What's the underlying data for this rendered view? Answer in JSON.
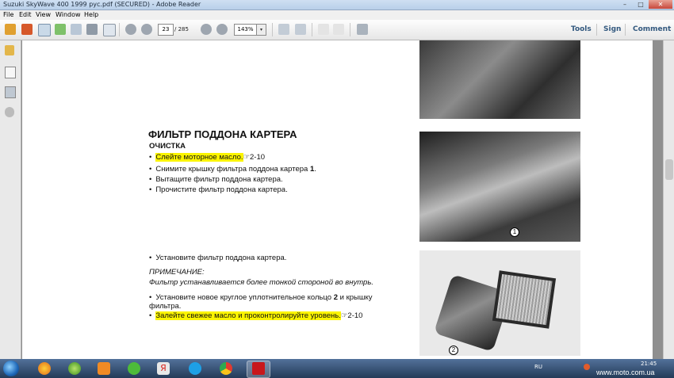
{
  "window": {
    "title": "Suzuki SkyWave 400 1999 рус.pdf (SECURED) - Adobe Reader",
    "controls": [
      "–",
      "□",
      "✕"
    ]
  },
  "menubar": {
    "items": [
      "File",
      "Edit",
      "View",
      "Window",
      "Help"
    ]
  },
  "toolbar": {
    "current_page": "23",
    "total_pages": "/ 285",
    "zoom": "143%",
    "right_links": [
      "Tools",
      "Sign",
      "Comment"
    ]
  },
  "document": {
    "heading": "ФИЛЬТР ПОДДОНА КАРТЕРА",
    "subheading": "ОЧИСТКА",
    "steps_top": [
      {
        "bullet": "•",
        "text": "Слейте моторное масло.",
        "highlighted": true,
        "ref": "☞2-10"
      },
      {
        "bullet": "•",
        "text": "Снимите крышку фильтра поддона картера",
        "bold_suffix": "1",
        "end": "."
      },
      {
        "bullet": "•",
        "text": "Вытащите фильтр поддона картера."
      },
      {
        "bullet": "•",
        "text": "Прочистите фильтр поддона картера."
      }
    ],
    "step_install": {
      "bullet": "•",
      "text": "Установите фильтр поддона картера."
    },
    "note_title": "ПРИМЕЧАНИЕ:",
    "note_text": "Фильтр устанавливается более тонкой стороной во внутрь.",
    "step_oring_1": "Установите новое круглое уплотнительное кольцо",
    "step_oring_bold": "2",
    "step_oring_2": "и крышку",
    "step_oring_3": "фильтра.",
    "step_oil": {
      "bullet": "•",
      "text": "Залейте свежее масло и проконтролируйте уровень.",
      "ref": "☞2-10"
    },
    "callouts": [
      "1",
      "2"
    ]
  },
  "taskbar": {
    "tray_lang": "RU",
    "time": "21:45"
  },
  "watermark": "www.moto.com.ua",
  "colors": {
    "highlight": "#fbf400",
    "link": "#33597f",
    "taskbar": "#2d4767"
  }
}
